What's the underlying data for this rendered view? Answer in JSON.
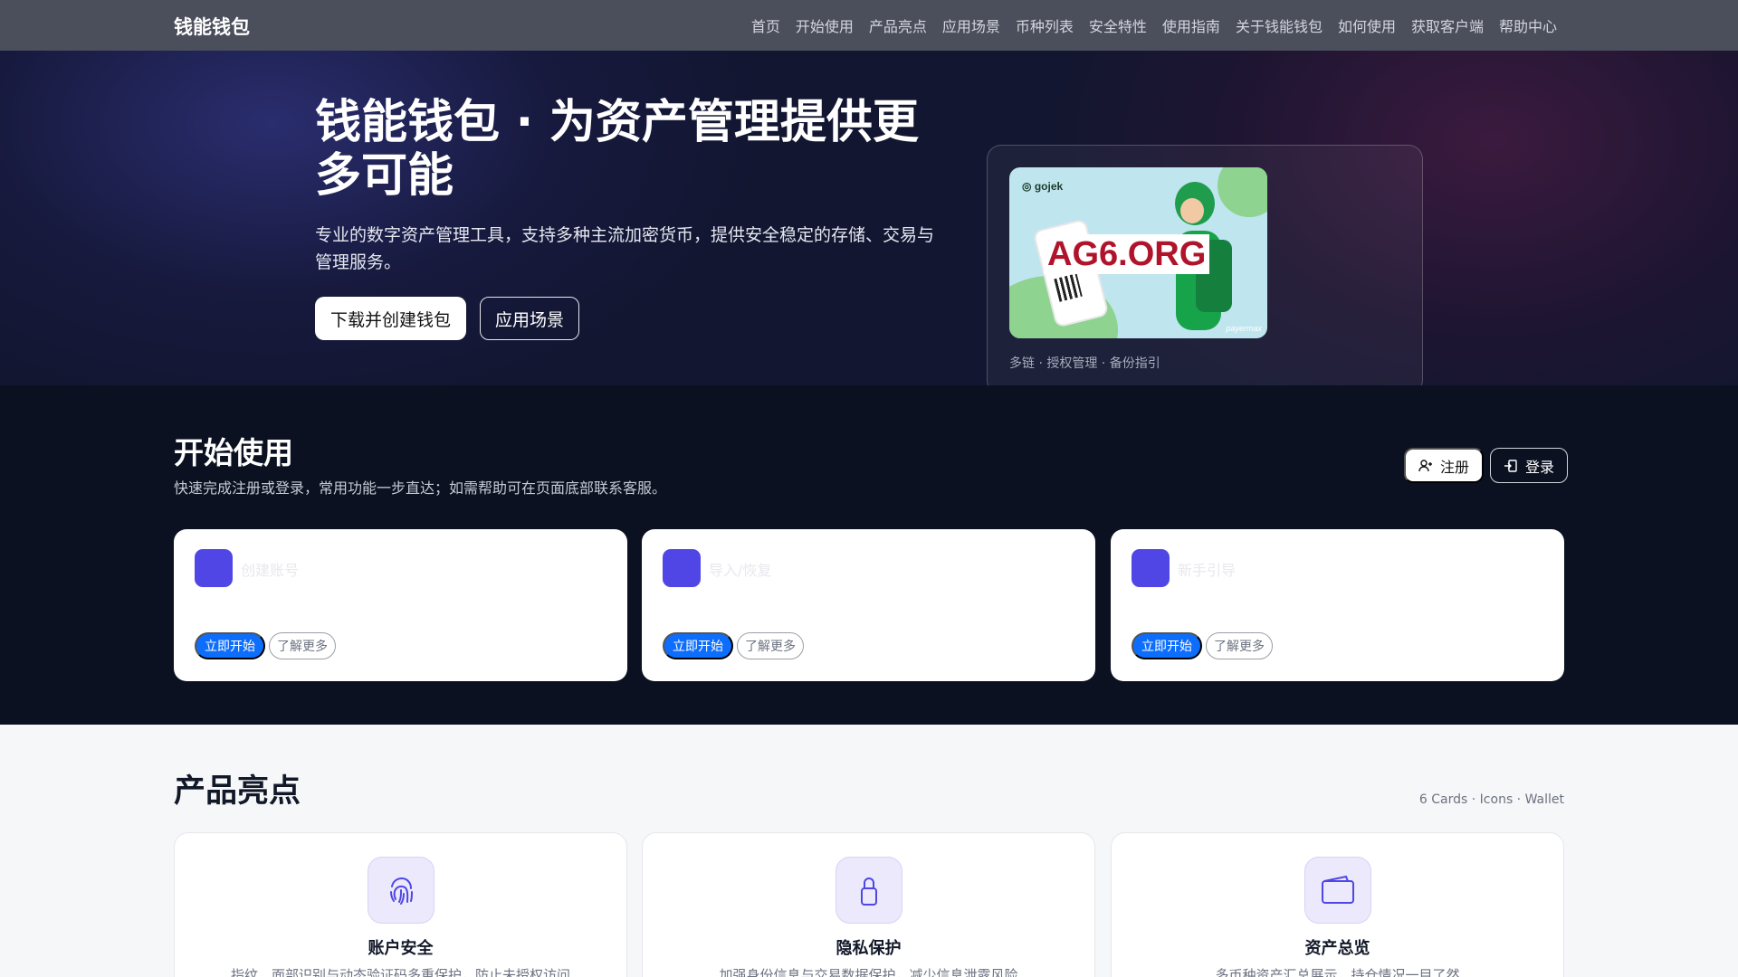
{
  "nav": {
    "brand": "钱能钱包",
    "links": [
      "首页",
      "开始使用",
      "产品亮点",
      "应用场景",
      "币种列表",
      "安全特性",
      "使用指南",
      "关于钱能钱包",
      "如何使用",
      "获取客户端",
      "帮助中心"
    ]
  },
  "hero": {
    "title": "钱能钱包 · 为资产管理提供更多可能",
    "description": "专业的数字资产管理工具，支持多种主流加密货币，提供安全稳定的存储、交易与管理服务。",
    "primary_button": "下载并创建钱包",
    "secondary_button": "应用场景",
    "card_caption": "多链 · 授权管理 · 备份指引",
    "promo": {
      "logo_text": "gojek",
      "overlay_text": "AG6.ORG",
      "brand_text": "payermax"
    }
  },
  "start": {
    "title": "开始使用",
    "description": "快速完成注册或登录，常用功能一步直达；如需帮助可在页面底部联系客服。",
    "register_label": "注册",
    "login_label": "登录",
    "cards": [
      {
        "title": "创建账号",
        "go_label": "立即开始",
        "more_label": "了解更多"
      },
      {
        "title": "导入/恢复",
        "go_label": "立即开始",
        "more_label": "了解更多"
      },
      {
        "title": "新手引导",
        "go_label": "立即开始",
        "more_label": "了解更多"
      }
    ]
  },
  "features": {
    "title": "产品亮点",
    "tag": "6 Cards · Icons · Wallet",
    "cards": [
      {
        "title": "账户安全",
        "description": "指纹、面部识别与动态验证码多重保护，防止未授权访问",
        "icon": "fingerprint-icon"
      },
      {
        "title": "隐私保护",
        "description": "加强身份信息与交易数据保护，减少信息泄露风险",
        "icon": "lock-icon"
      },
      {
        "title": "资产总览",
        "description": "多币种资产汇总展示，持仓情况一目了然",
        "icon": "wallet-icon"
      }
    ]
  },
  "colors": {
    "accent": "#4f46e5",
    "primary_button": "#0d6efd",
    "nav_bg": "#4b4f5c",
    "dark_bg": "#0b1120"
  }
}
